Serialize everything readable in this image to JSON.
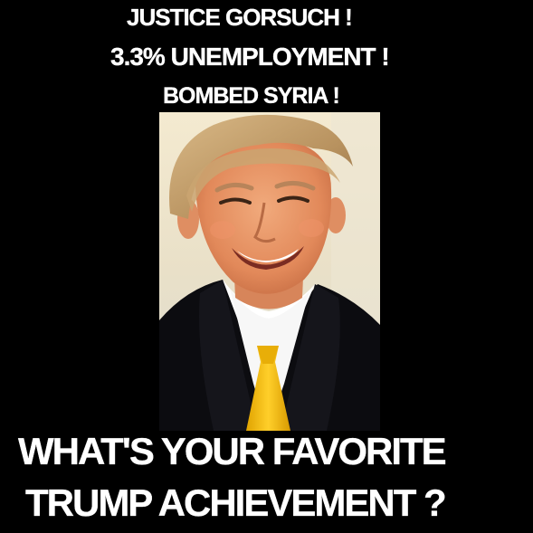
{
  "meme": {
    "top_lines": [
      "JUSTICE GORSUCH !",
      "3.3% UNEMPLOYMENT !",
      "BOMBED SYRIA !"
    ],
    "bottom_lines": [
      "WHAT'S YOUR FAVORITE",
      "TRUMP ACHIEVEMENT ?"
    ]
  },
  "colors": {
    "background": "#000000",
    "text": "#ffffff",
    "tie": "#f2b705",
    "sky": "#efe4c8",
    "hair": "#c8a574",
    "skin": "#e99a6a",
    "suit": "#0c0c10",
    "shirt": "#ffffff"
  }
}
